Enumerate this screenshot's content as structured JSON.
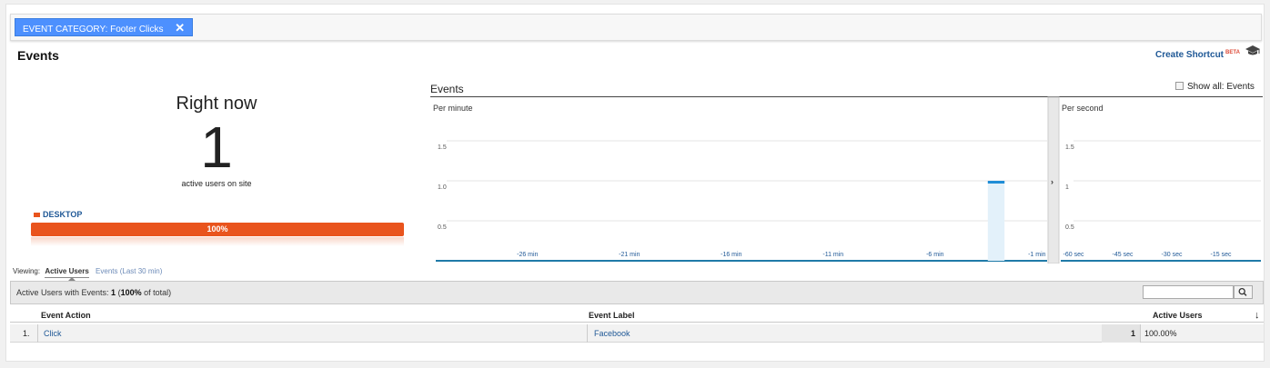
{
  "filter": {
    "label": "EVENT CATEGORY: Footer Clicks"
  },
  "header": {
    "title": "Events",
    "shortcut_label": "Create Shortcut",
    "shortcut_badge": "BETA"
  },
  "right_now": {
    "label": "Right now",
    "value": "1",
    "subtitle": "active users on site"
  },
  "device": {
    "label": "DESKTOP",
    "percent_label": "100%",
    "fraction": 1.0,
    "color": "#e9541d"
  },
  "chart": {
    "title": "Events",
    "show_all_label": "Show all: Events"
  },
  "chart_data": [
    {
      "type": "bar",
      "title": "Per minute",
      "categories": [
        "-26 min",
        "-21 min",
        "-16 min",
        "-11 min",
        "-6 min",
        "-1 min"
      ],
      "x_ticks": [
        "-26 min",
        "-21 min",
        "-16 min",
        "-11 min",
        "-6 min",
        "-1 min"
      ],
      "y_ticks": [
        "1.5",
        "1.0",
        "0.5"
      ],
      "ylim": [
        0,
        1.5
      ],
      "bins": 30,
      "values_by_minute_ago": {
        "3": 1
      },
      "grid": true,
      "color": "#1f8dd6"
    },
    {
      "type": "bar",
      "title": "Per second",
      "x_ticks": [
        "-60 sec",
        "-45 sec",
        "-30 sec",
        "-15 sec"
      ],
      "y_ticks": [
        "1.5",
        "1",
        "0.5"
      ],
      "ylim": [
        0,
        1.5
      ],
      "values": [],
      "grid": true
    }
  ],
  "viewing": {
    "prefix": "Viewing:",
    "active_tab": "Active Users",
    "other_tab": "Events (Last 30 min)"
  },
  "summary": {
    "prefix": "Active Users with Events:",
    "value": "1",
    "percent": "100%",
    "suffix": "of total)"
  },
  "table": {
    "headers": {
      "action": "Event Action",
      "label": "Event Label",
      "users": "Active Users"
    },
    "rows": [
      {
        "index": "1.",
        "action": "Click",
        "label": "Facebook",
        "users": "1",
        "percent": "100.00%"
      }
    ]
  }
}
